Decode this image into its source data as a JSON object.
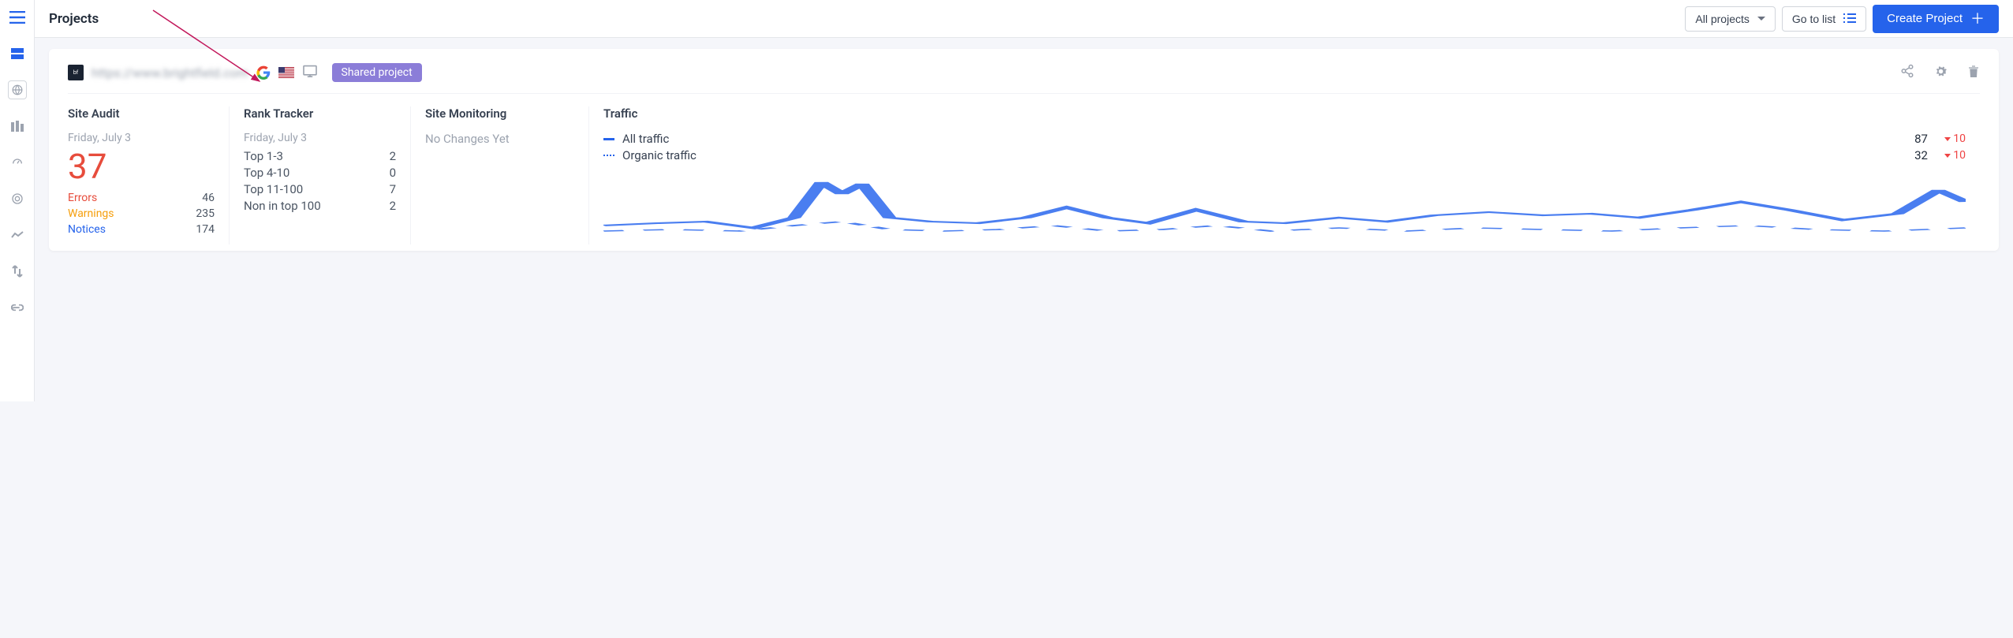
{
  "header": {
    "title": "Projects",
    "filter_label": "All projects",
    "goto_label": "Go to list",
    "create_label": "Create Project"
  },
  "project": {
    "url": "https://www.brightfield.com",
    "badge": "Shared project"
  },
  "site_audit": {
    "title": "Site Audit",
    "date": "Friday, July 3",
    "score": "37",
    "errors_label": "Errors",
    "errors_value": "46",
    "warnings_label": "Warnings",
    "warnings_value": "235",
    "notices_label": "Notices",
    "notices_value": "174"
  },
  "rank_tracker": {
    "title": "Rank Tracker",
    "date": "Friday, July 3",
    "rows": [
      {
        "label": "Top 1-3",
        "value": "2"
      },
      {
        "label": "Top 4-10",
        "value": "0"
      },
      {
        "label": "Top 11-100",
        "value": "7"
      },
      {
        "label": "Non in top 100",
        "value": "2"
      }
    ]
  },
  "site_monitoring": {
    "title": "Site Monitoring",
    "message": "No Changes Yet"
  },
  "traffic": {
    "title": "Traffic",
    "rows": [
      {
        "label": "All traffic",
        "value": "87",
        "delta": "10"
      },
      {
        "label": "Organic traffic",
        "value": "32",
        "delta": "10"
      }
    ]
  }
}
